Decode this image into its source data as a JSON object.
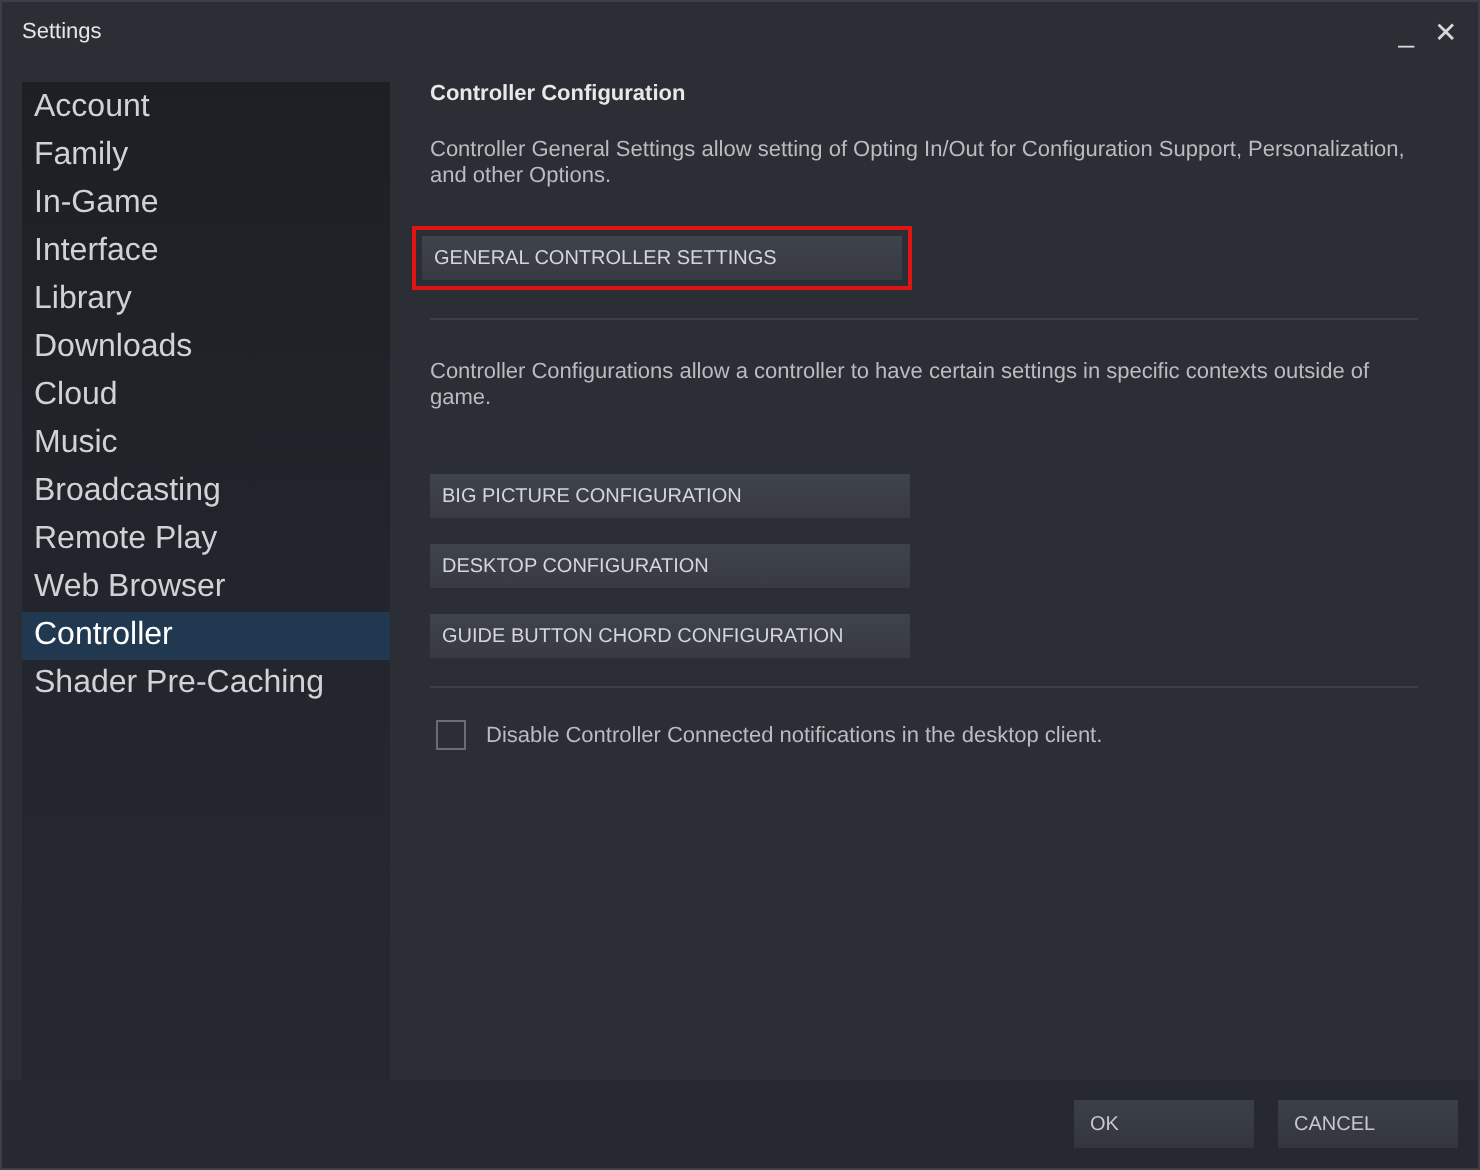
{
  "window": {
    "title": "Settings",
    "minimize": "_",
    "close": "✕"
  },
  "sidebar": {
    "items": [
      {
        "label": "Account",
        "selected": false
      },
      {
        "label": "Family",
        "selected": false
      },
      {
        "label": "In-Game",
        "selected": false
      },
      {
        "label": "Interface",
        "selected": false
      },
      {
        "label": "Library",
        "selected": false
      },
      {
        "label": "Downloads",
        "selected": false
      },
      {
        "label": "Cloud",
        "selected": false
      },
      {
        "label": "Music",
        "selected": false
      },
      {
        "label": "Broadcasting",
        "selected": false
      },
      {
        "label": "Remote Play",
        "selected": false
      },
      {
        "label": "Web Browser",
        "selected": false
      },
      {
        "label": "Controller",
        "selected": true
      },
      {
        "label": "Shader Pre-Caching",
        "selected": false
      }
    ]
  },
  "content": {
    "heading": "Controller Configuration",
    "general_text": "Controller General Settings allow setting of Opting In/Out for Configuration Support, Personalization, and other Options.",
    "general_button": {
      "label": "GENERAL CONTROLLER SETTINGS",
      "highlighted": true
    },
    "config_text": "Controller Configurations allow a controller to have certain settings in specific contexts outside of game.",
    "config_buttons": [
      {
        "label": "BIG PICTURE CONFIGURATION"
      },
      {
        "label": "DESKTOP CONFIGURATION"
      },
      {
        "label": "GUIDE BUTTON CHORD CONFIGURATION"
      }
    ],
    "checkbox": {
      "label": "Disable Controller Connected notifications in the desktop client.",
      "checked": false
    }
  },
  "buttons": [
    "OK",
    "CANCEL"
  ]
}
